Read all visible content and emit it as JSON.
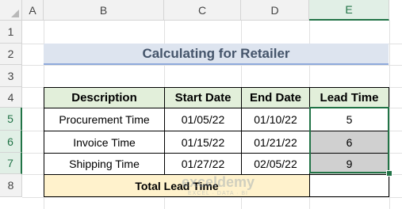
{
  "columns": [
    "A",
    "B",
    "C",
    "D",
    "E"
  ],
  "rows": [
    "1",
    "2",
    "3",
    "4",
    "5",
    "6",
    "7",
    "8"
  ],
  "title": "Calculating for Retailer",
  "table": {
    "headers": [
      "Description",
      "Start Date",
      "End Date",
      "Lead Time"
    ],
    "rows": [
      [
        "Procurement Time",
        "01/05/22",
        "01/10/22",
        "5"
      ],
      [
        "Invoice Time",
        "01/15/22",
        "01/21/22",
        "6"
      ],
      [
        "Shipping Time",
        "01/27/22",
        "02/05/22",
        "9"
      ]
    ],
    "total_label": "Total Lead Time",
    "total_value": ""
  },
  "watermark": {
    "brand": "exceldemy",
    "tagline": "EXCEL · DATA · BI"
  },
  "colors": {
    "header_fill": "#e2efda",
    "title_fill": "#dde4ef",
    "total_fill": "#fff2cc",
    "selection": "#217346"
  }
}
